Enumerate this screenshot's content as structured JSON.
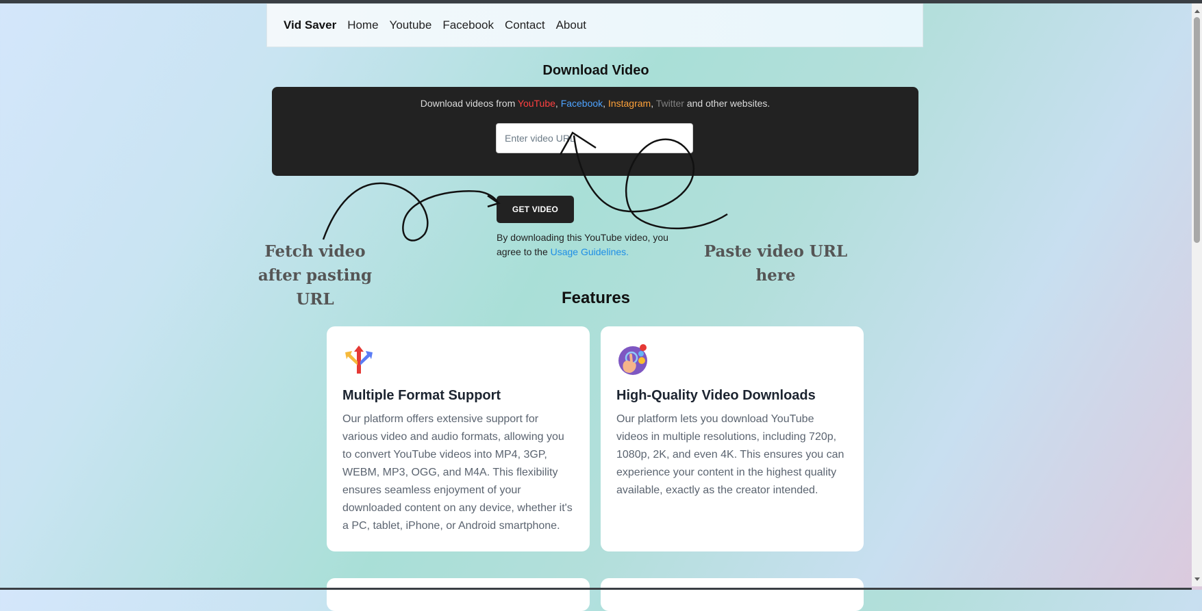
{
  "nav": {
    "brand": "Vid Saver",
    "links": [
      "Home",
      "Youtube",
      "Facebook",
      "Contact",
      "About"
    ]
  },
  "hero": {
    "title": "Download Video",
    "panel_prefix": "Download videos from ",
    "sites": [
      "YouTube",
      "Facebook",
      "Instagram",
      "Twitter"
    ],
    "panel_suffix": " and other websites.",
    "input_placeholder": "Enter video URL",
    "button_label": "GET VIDEO",
    "agree_text": "By downloading this YouTube video, you agree to the ",
    "agree_link": "Usage Guidelines."
  },
  "annotations": {
    "left": "Fetch video after pasting URL",
    "right": "Paste video URL here"
  },
  "features": {
    "title": "Features",
    "cards": [
      {
        "icon": "arrows-split-icon",
        "title": "Multiple Format Support",
        "body": "Our platform offers extensive support for various video and audio formats, allowing you to convert YouTube videos into MP4, 3GP, WEBM, MP3, OGG, and M4A. This flexibility ensures seamless enjoyment of your downloaded content on any device, whether it's a PC, tablet, iPhone, or Android smartphone."
      },
      {
        "icon": "hand-tap-quality-icon",
        "title": "High-Quality Video Downloads",
        "body": "Our platform lets you download YouTube videos in multiple resolutions, including 720p, 1080p, 2K, and even 4K. This ensures you can experience your content in the highest quality available, exactly as the creator intended."
      }
    ]
  },
  "colors": {
    "youtube": "#ff4040",
    "facebook": "#4ea3ff",
    "instagram": "#ffa23a",
    "twitter": "#808080",
    "link": "#1d8ee6"
  }
}
